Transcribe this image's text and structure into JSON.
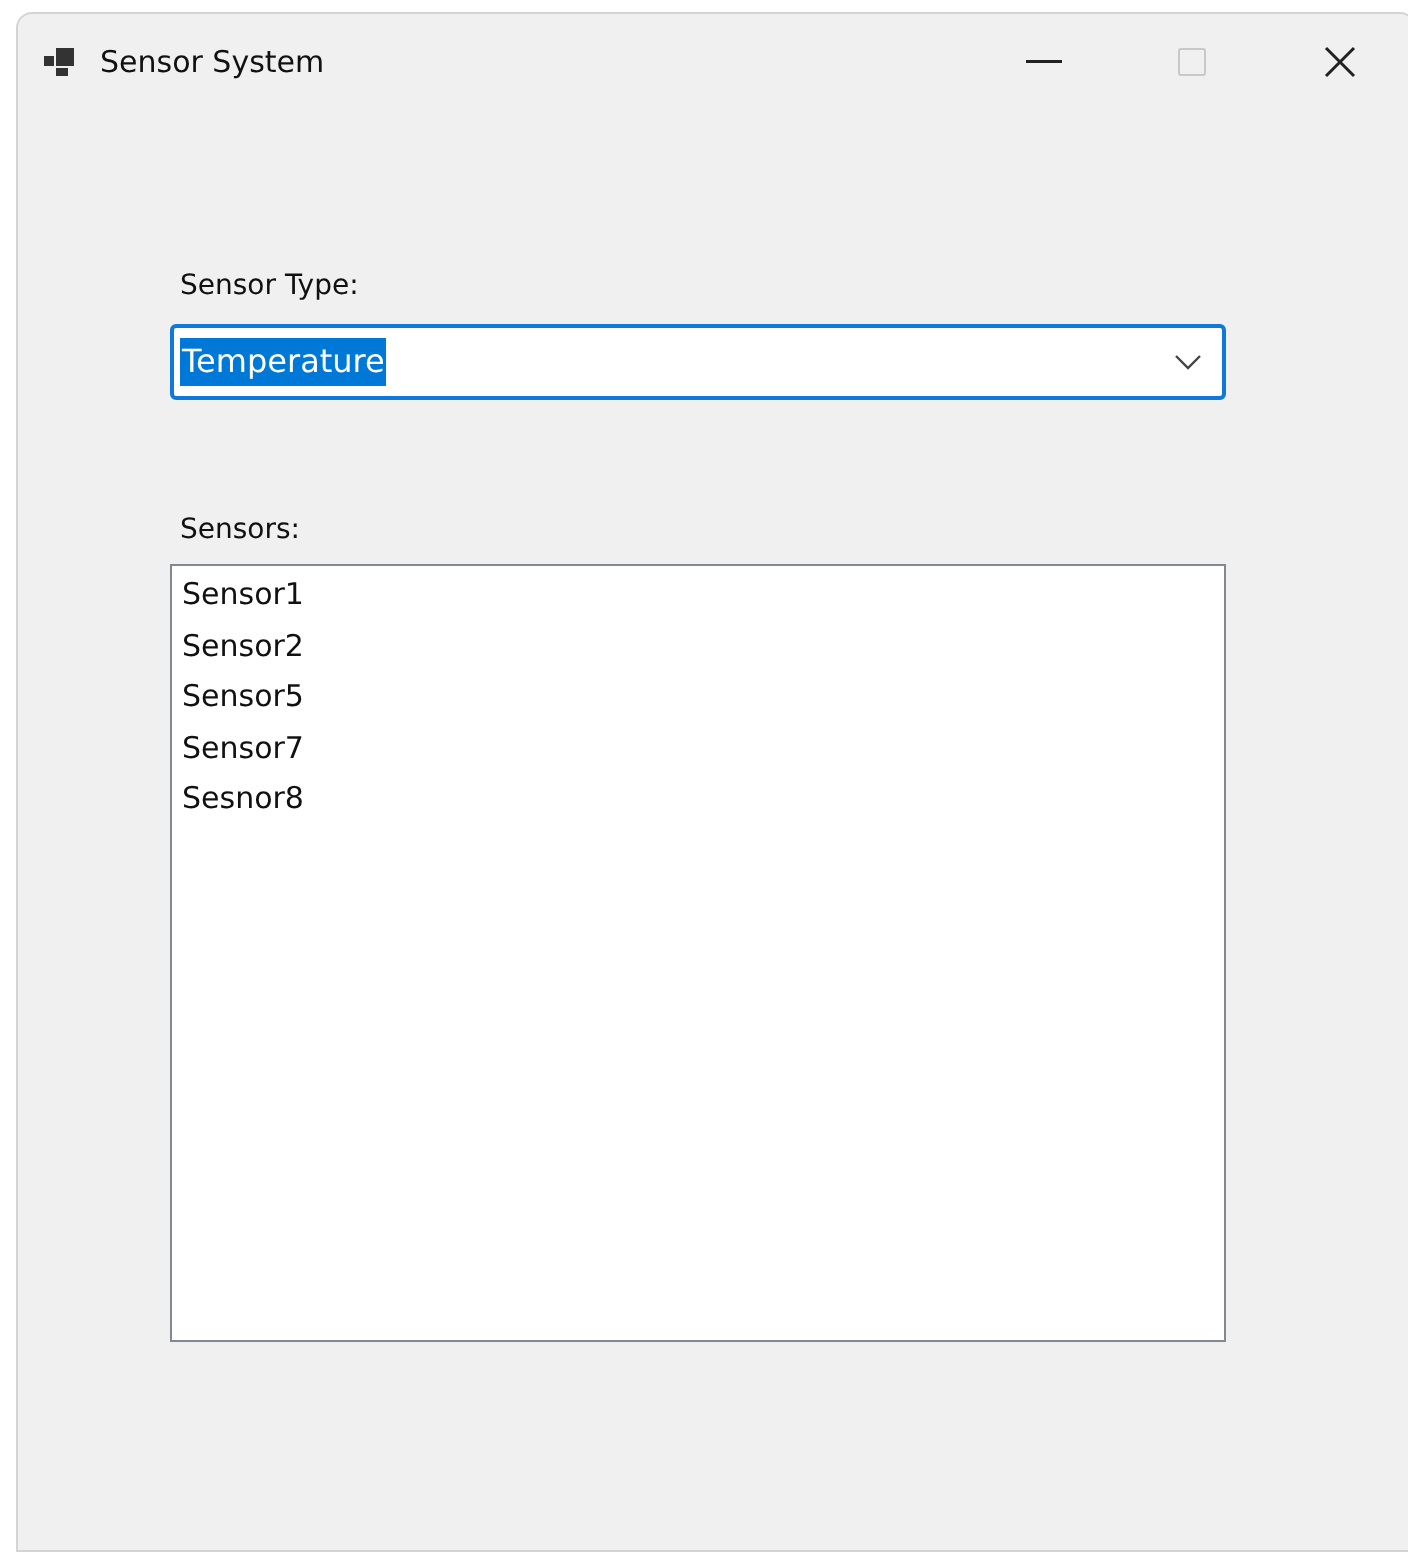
{
  "window": {
    "title": "Sensor System",
    "maximize_disabled": true
  },
  "sensor_type": {
    "label": "Sensor Type:",
    "value": "Temperature",
    "text_selected": true
  },
  "sensors": {
    "label": "Sensors:",
    "items": [
      "Sensor1",
      "Sensor2",
      "Sensor5",
      "Sensor7",
      "Sesnor8"
    ]
  }
}
